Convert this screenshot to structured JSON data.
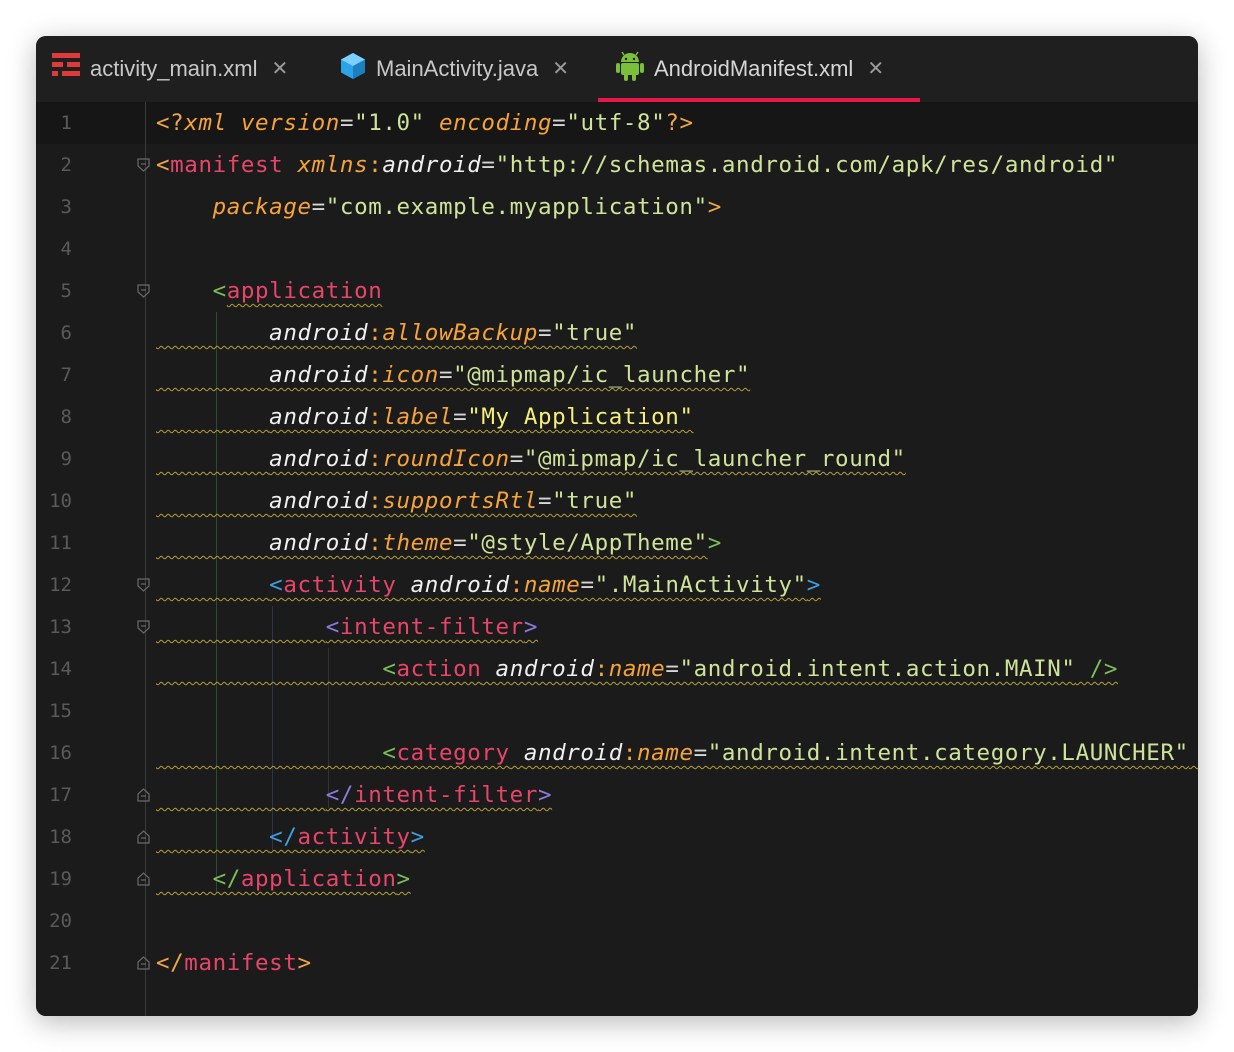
{
  "tabs": [
    {
      "label": "activity_main.xml",
      "icon": "layout-xml-icon",
      "active": false
    },
    {
      "label": "MainActivity.java",
      "icon": "java-class-icon",
      "active": false
    },
    {
      "label": "AndroidManifest.xml",
      "icon": "android-icon",
      "active": true
    }
  ],
  "line_numbers": [
    "1",
    "2",
    "3",
    "4",
    "5",
    "6",
    "7",
    "8",
    "9",
    "10",
    "11",
    "12",
    "13",
    "14",
    "15",
    "16",
    "17",
    "18",
    "19",
    "20",
    "21"
  ],
  "code": {
    "l1": {
      "open": "<?",
      "name": "xml",
      "a1": "version",
      "v1": "\"1.0\"",
      "a2": "encoding",
      "v2": "\"utf-8\"",
      "close": "?>"
    },
    "l2": {
      "tag": "manifest",
      "ns": "xmlns",
      "colon": ":",
      "attr": "android",
      "val": "\"http://schemas.android.com/apk/res/android\""
    },
    "l3": {
      "attr": "package",
      "val": "\"com.example.myapplication\""
    },
    "l5": {
      "tag": "application"
    },
    "l6": {
      "ns": "android",
      "attr": "allowBackup",
      "val": "\"true\""
    },
    "l7": {
      "ns": "android",
      "attr": "icon",
      "val": "\"@mipmap/ic_launcher\""
    },
    "l8": {
      "ns": "android",
      "attr": "label",
      "val": "\"My Application\""
    },
    "l9": {
      "ns": "android",
      "attr": "roundIcon",
      "val": "\"@mipmap/ic_launcher_round\""
    },
    "l10": {
      "ns": "android",
      "attr": "supportsRtl",
      "val": "\"true\""
    },
    "l11": {
      "ns": "android",
      "attr": "theme",
      "val": "\"@style/AppTheme\""
    },
    "l12": {
      "tag": "activity",
      "ns": "android",
      "attr": "name",
      "val": "\".MainActivity\""
    },
    "l13": {
      "tag": "intent-filter"
    },
    "l14": {
      "tag": "action",
      "ns": "android",
      "attr": "name",
      "val": "\"android.intent.action.MAIN\""
    },
    "l16": {
      "tag": "category",
      "ns": "android",
      "attr": "name",
      "val": "\"android.intent.category.LAUNCHER\""
    },
    "l17": {
      "tag": "intent-filter"
    },
    "l18": {
      "tag": "activity"
    },
    "l19": {
      "tag": "application"
    },
    "l21": {
      "tag": "manifest"
    }
  },
  "colors": {
    "accent": "#e8194a",
    "background": "#1b1b1b",
    "tag": "#e8456a",
    "attribute": "#f6a33a",
    "string": "#cfe39a"
  }
}
